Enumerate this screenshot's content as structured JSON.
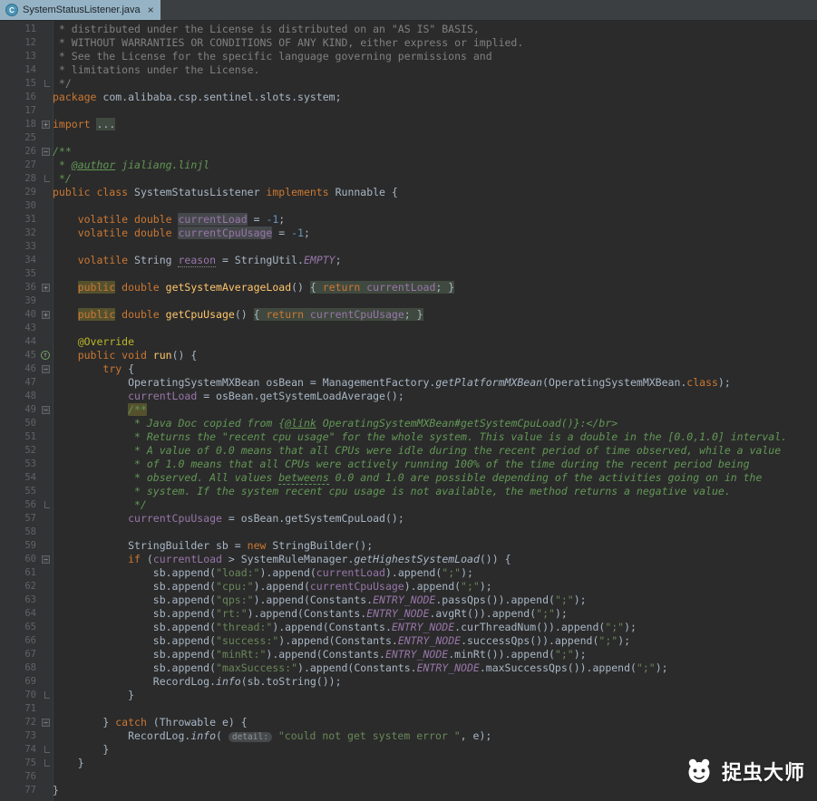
{
  "tab_bar": {
    "active_tab": {
      "title": "SystemStatusListener.java",
      "icon_letter": "C",
      "close_label": "×"
    }
  },
  "watermark": {
    "text": "捉虫大师"
  },
  "colors": {
    "editor_background": "#2b2b2b",
    "gutter_background": "#313335",
    "tab_bar_background": "#3c3f41",
    "active_tab_background": "#95b3c5",
    "keyword": "#cc7832",
    "string": "#6a8759",
    "comment": "#808080",
    "javadoc": "#629755",
    "field": "#9876aa",
    "number": "#6897bb",
    "method_declaration": "#ffc66b",
    "annotation": "#bbb529",
    "default_text": "#a9b7c6",
    "line_number": "#606366"
  },
  "editor": {
    "lines": [
      {
        "n": "11",
        "g": "",
        "seg": [
          [
            "comment",
            " * distributed under the License is distributed on an \"AS IS\" BASIS,"
          ]
        ]
      },
      {
        "n": "12",
        "g": "",
        "seg": [
          [
            "comment",
            " * WITHOUT WARRANTIES OR CONDITIONS OF ANY KIND, either express or implied."
          ]
        ]
      },
      {
        "n": "13",
        "g": "",
        "seg": [
          [
            "comment",
            " * See the License for the specific language governing permissions and"
          ]
        ]
      },
      {
        "n": "14",
        "g": "",
        "seg": [
          [
            "comment",
            " * limitations under the License."
          ]
        ]
      },
      {
        "n": "15",
        "g": "end",
        "seg": [
          [
            "comment",
            " */"
          ]
        ]
      },
      {
        "n": "16",
        "g": "",
        "seg": [
          [
            "keyword",
            "package "
          ],
          [
            "plain",
            "com.alibaba.csp.sentinel.slots.system;"
          ]
        ]
      },
      {
        "n": "17",
        "g": "",
        "seg": []
      },
      {
        "n": "18",
        "g": "plus",
        "seg": [
          [
            "keyword",
            "import "
          ],
          [
            "fold plain",
            "..."
          ]
        ]
      },
      {
        "n": "25",
        "g": "",
        "seg": []
      },
      {
        "n": "26",
        "g": "minus",
        "seg": [
          [
            "doc",
            "/**"
          ]
        ]
      },
      {
        "n": "27",
        "g": "",
        "seg": [
          [
            "doc",
            " * "
          ],
          [
            "doc-tag",
            "@author"
          ],
          [
            "doc",
            " jialiang.linjl"
          ]
        ]
      },
      {
        "n": "28",
        "g": "end",
        "seg": [
          [
            "doc",
            " */"
          ]
        ]
      },
      {
        "n": "29",
        "g": "",
        "seg": [
          [
            "keyword",
            "public class "
          ],
          [
            "plain",
            "SystemStatusListener "
          ],
          [
            "keyword",
            "implements "
          ],
          [
            "plain",
            "Runnable {"
          ]
        ]
      },
      {
        "n": "30",
        "g": "",
        "seg": []
      },
      {
        "n": "31",
        "g": "",
        "seg": [
          [
            "plain",
            "    "
          ],
          [
            "keyword",
            "volatile double "
          ],
          [
            "field hl-gray",
            "currentLoad"
          ],
          [
            "plain",
            " = "
          ],
          [
            "number",
            "-1"
          ],
          [
            "plain",
            ";"
          ]
        ]
      },
      {
        "n": "32",
        "g": "",
        "seg": [
          [
            "plain",
            "    "
          ],
          [
            "keyword",
            "volatile double "
          ],
          [
            "field hl-gray",
            "currentCpuUsage"
          ],
          [
            "plain",
            " = "
          ],
          [
            "number",
            "-1"
          ],
          [
            "plain",
            ";"
          ]
        ]
      },
      {
        "n": "33",
        "g": "",
        "seg": []
      },
      {
        "n": "34",
        "g": "",
        "seg": [
          [
            "plain",
            "    "
          ],
          [
            "keyword",
            "volatile "
          ],
          [
            "plain",
            "String "
          ],
          [
            "field spell",
            "reason"
          ],
          [
            "plain",
            " = StringUtil."
          ],
          [
            "static",
            "EMPTY"
          ],
          [
            "plain",
            ";"
          ]
        ]
      },
      {
        "n": "35",
        "g": "",
        "seg": []
      },
      {
        "n": "36",
        "g": "plus",
        "seg": [
          [
            "plain",
            "    "
          ],
          [
            "keyword hl-olive",
            "public"
          ],
          [
            "keyword",
            " double "
          ],
          [
            "method",
            "getSystemAverageLoad"
          ],
          [
            "plain",
            "() "
          ],
          [
            "fold plain",
            "{ "
          ],
          [
            "fold keyword",
            "return"
          ],
          [
            "fold field",
            " currentLoad"
          ],
          [
            "fold plain",
            "; }"
          ]
        ]
      },
      {
        "n": "39",
        "g": "",
        "seg": []
      },
      {
        "n": "40",
        "g": "plus",
        "seg": [
          [
            "plain",
            "    "
          ],
          [
            "keyword hl-olive",
            "public"
          ],
          [
            "keyword",
            " double "
          ],
          [
            "method",
            "getCpuUsage"
          ],
          [
            "plain",
            "() "
          ],
          [
            "fold plain",
            "{ "
          ],
          [
            "fold keyword",
            "return"
          ],
          [
            "fold field",
            " currentCpuUsage"
          ],
          [
            "fold plain",
            "; }"
          ]
        ]
      },
      {
        "n": "43",
        "g": "",
        "seg": []
      },
      {
        "n": "44",
        "g": "",
        "seg": [
          [
            "plain",
            "    "
          ],
          [
            "annotation",
            "@Override"
          ]
        ]
      },
      {
        "n": "45",
        "g": "ovr",
        "seg": [
          [
            "plain",
            "    "
          ],
          [
            "keyword",
            "public void "
          ],
          [
            "method",
            "run"
          ],
          [
            "plain",
            "() {"
          ]
        ]
      },
      {
        "n": "46",
        "g": "minus",
        "seg": [
          [
            "plain",
            "        "
          ],
          [
            "keyword",
            "try"
          ],
          [
            "plain",
            " {"
          ]
        ]
      },
      {
        "n": "47",
        "g": "",
        "seg": [
          [
            "plain",
            "            OperatingSystemMXBean osBean = ManagementFactory."
          ],
          [
            "static-call",
            "getPlatformMXBean"
          ],
          [
            "plain",
            "(OperatingSystemMXBean."
          ],
          [
            "keyword",
            "class"
          ],
          [
            "plain",
            ");"
          ]
        ]
      },
      {
        "n": "48",
        "g": "",
        "seg": [
          [
            "plain",
            "            "
          ],
          [
            "field",
            "currentLoad"
          ],
          [
            "plain",
            " = osBean.getSystemLoadAverage();"
          ]
        ]
      },
      {
        "n": "49",
        "g": "minus",
        "seg": [
          [
            "plain",
            "            "
          ],
          [
            "doc hl-olive",
            "/**"
          ]
        ]
      },
      {
        "n": "50",
        "g": "",
        "seg": [
          [
            "doc",
            "             * Java Doc copied from {"
          ],
          [
            "doc-tag",
            "@link"
          ],
          [
            "doc",
            " OperatingSystemMXBean#getSystemCpuLoad()}:</br>"
          ]
        ]
      },
      {
        "n": "51",
        "g": "",
        "seg": [
          [
            "doc",
            "             * Returns the \"recent cpu usage\" for the whole system. This value is a double in the [0.0,1.0] interval."
          ]
        ]
      },
      {
        "n": "52",
        "g": "",
        "seg": [
          [
            "doc",
            "             * A value of 0.0 means that all CPUs were idle during the recent period of time observed, while a value"
          ]
        ]
      },
      {
        "n": "53",
        "g": "",
        "seg": [
          [
            "doc",
            "             * of 1.0 means that all CPUs were actively running 100% of the time during the recent period being"
          ]
        ]
      },
      {
        "n": "54",
        "g": "",
        "seg": [
          [
            "doc",
            "             * observed. All values "
          ],
          [
            "doc typo",
            "betweens"
          ],
          [
            "doc",
            " 0.0 and 1.0 are possible depending of the activities going on in the"
          ]
        ]
      },
      {
        "n": "55",
        "g": "",
        "seg": [
          [
            "doc",
            "             * system. If the system recent cpu usage is not available, the method returns a negative value."
          ]
        ]
      },
      {
        "n": "56",
        "g": "end",
        "seg": [
          [
            "doc",
            "             */"
          ]
        ]
      },
      {
        "n": "57",
        "g": "",
        "seg": [
          [
            "plain",
            "            "
          ],
          [
            "field",
            "currentCpuUsage"
          ],
          [
            "plain",
            " = osBean.getSystemCpuLoad();"
          ]
        ]
      },
      {
        "n": "58",
        "g": "",
        "seg": []
      },
      {
        "n": "59",
        "g": "",
        "seg": [
          [
            "plain",
            "            StringBuilder sb = "
          ],
          [
            "keyword",
            "new"
          ],
          [
            "plain",
            " StringBuilder();"
          ]
        ]
      },
      {
        "n": "60",
        "g": "minus",
        "seg": [
          [
            "plain",
            "            "
          ],
          [
            "keyword",
            "if"
          ],
          [
            "plain",
            " ("
          ],
          [
            "field",
            "currentLoad"
          ],
          [
            "plain",
            " > SystemRuleManager."
          ],
          [
            "static-call",
            "getHighestSystemLoad"
          ],
          [
            "plain",
            "()) {"
          ]
        ]
      },
      {
        "n": "61",
        "g": "",
        "seg": [
          [
            "plain",
            "                sb.append("
          ],
          [
            "string",
            "\"load:\""
          ],
          [
            "plain",
            ").append("
          ],
          [
            "field",
            "currentLoad"
          ],
          [
            "plain",
            ").append("
          ],
          [
            "string",
            "\";\""
          ],
          [
            "plain",
            ");"
          ]
        ]
      },
      {
        "n": "62",
        "g": "",
        "seg": [
          [
            "plain",
            "                sb.append("
          ],
          [
            "string",
            "\"cpu:\""
          ],
          [
            "plain",
            ").append("
          ],
          [
            "field",
            "currentCpuUsage"
          ],
          [
            "plain",
            ").append("
          ],
          [
            "string",
            "\";\""
          ],
          [
            "plain",
            ");"
          ]
        ]
      },
      {
        "n": "63",
        "g": "",
        "seg": [
          [
            "plain",
            "                sb.append("
          ],
          [
            "string",
            "\"qps:\""
          ],
          [
            "plain",
            ").append(Constants."
          ],
          [
            "static",
            "ENTRY_NODE"
          ],
          [
            "plain",
            ".passQps()).append("
          ],
          [
            "string",
            "\";\""
          ],
          [
            "plain",
            ");"
          ]
        ]
      },
      {
        "n": "64",
        "g": "",
        "seg": [
          [
            "plain",
            "                sb.append("
          ],
          [
            "string",
            "\"rt:\""
          ],
          [
            "plain",
            ").append(Constants."
          ],
          [
            "static",
            "ENTRY_NODE"
          ],
          [
            "plain",
            ".avgRt()).append("
          ],
          [
            "string",
            "\";\""
          ],
          [
            "plain",
            ");"
          ]
        ]
      },
      {
        "n": "65",
        "g": "",
        "seg": [
          [
            "plain",
            "                sb.append("
          ],
          [
            "string",
            "\"thread:\""
          ],
          [
            "plain",
            ").append(Constants."
          ],
          [
            "static",
            "ENTRY_NODE"
          ],
          [
            "plain",
            ".curThreadNum()).append("
          ],
          [
            "string",
            "\";\""
          ],
          [
            "plain",
            ");"
          ]
        ]
      },
      {
        "n": "66",
        "g": "",
        "seg": [
          [
            "plain",
            "                sb.append("
          ],
          [
            "string",
            "\"success:\""
          ],
          [
            "plain",
            ").append(Constants."
          ],
          [
            "static",
            "ENTRY_NODE"
          ],
          [
            "plain",
            ".successQps()).append("
          ],
          [
            "string",
            "\";\""
          ],
          [
            "plain",
            ");"
          ]
        ]
      },
      {
        "n": "67",
        "g": "",
        "seg": [
          [
            "plain",
            "                sb.append("
          ],
          [
            "string",
            "\"minRt:\""
          ],
          [
            "plain",
            ").append(Constants."
          ],
          [
            "static",
            "ENTRY_NODE"
          ],
          [
            "plain",
            ".minRt()).append("
          ],
          [
            "string",
            "\";\""
          ],
          [
            "plain",
            ");"
          ]
        ]
      },
      {
        "n": "68",
        "g": "",
        "seg": [
          [
            "plain",
            "                sb.append("
          ],
          [
            "string",
            "\"maxSuccess:\""
          ],
          [
            "plain",
            ").append(Constants."
          ],
          [
            "static",
            "ENTRY_NODE"
          ],
          [
            "plain",
            ".maxSuccessQps()).append("
          ],
          [
            "string",
            "\";\""
          ],
          [
            "plain",
            ");"
          ]
        ]
      },
      {
        "n": "69",
        "g": "",
        "seg": [
          [
            "plain",
            "                RecordLog."
          ],
          [
            "static-call",
            "info"
          ],
          [
            "plain",
            "(sb.toString());"
          ]
        ]
      },
      {
        "n": "70",
        "g": "end",
        "seg": [
          [
            "plain",
            "            }"
          ]
        ]
      },
      {
        "n": "71",
        "g": "",
        "seg": []
      },
      {
        "n": "72",
        "g": "minus",
        "seg": [
          [
            "plain",
            "        } "
          ],
          [
            "keyword",
            "catch"
          ],
          [
            "plain",
            " (Throwable e) {"
          ]
        ]
      },
      {
        "n": "73",
        "g": "",
        "seg": [
          [
            "plain",
            "            RecordLog."
          ],
          [
            "static-call",
            "info"
          ],
          [
            "plain",
            "( "
          ],
          [
            "hint",
            "detail:"
          ],
          [
            "plain",
            " "
          ],
          [
            "string",
            "\"could not get system error \""
          ],
          [
            "plain",
            ", e);"
          ]
        ]
      },
      {
        "n": "74",
        "g": "end",
        "seg": [
          [
            "plain",
            "        }"
          ]
        ]
      },
      {
        "n": "75",
        "g": "end",
        "seg": [
          [
            "plain",
            "    }"
          ]
        ]
      },
      {
        "n": "76",
        "g": "",
        "seg": []
      },
      {
        "n": "77",
        "g": "",
        "seg": [
          [
            "plain",
            "}"
          ]
        ]
      }
    ]
  }
}
